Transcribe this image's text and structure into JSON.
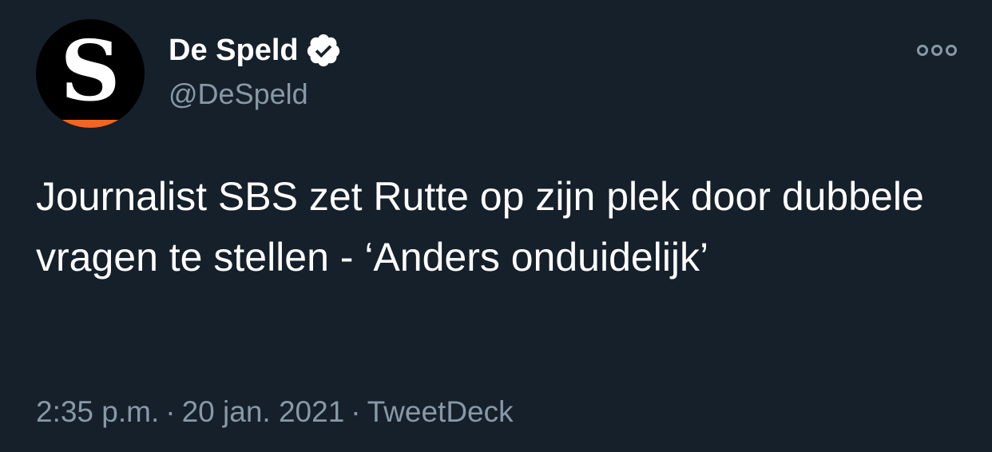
{
  "account": {
    "avatar_letter": "S",
    "avatar_accent": "#f26522",
    "display_name": "De Speld",
    "verified_icon": "verified-badge-icon",
    "handle": "@DeSpeld"
  },
  "tweet": {
    "text": "Journalist SBS zet Rutte op zijn plek door dubbele vragen te stellen - ‘Anders onduidelijk’",
    "time": "2:35 p.m.",
    "separator": "·",
    "date": "20 jan. 2021",
    "source": "TweetDeck"
  },
  "menu": {
    "icon": "more-options-icon"
  },
  "colors": {
    "background": "#15202b",
    "primary_text": "#ffffff",
    "secondary_text": "#8899a6"
  }
}
